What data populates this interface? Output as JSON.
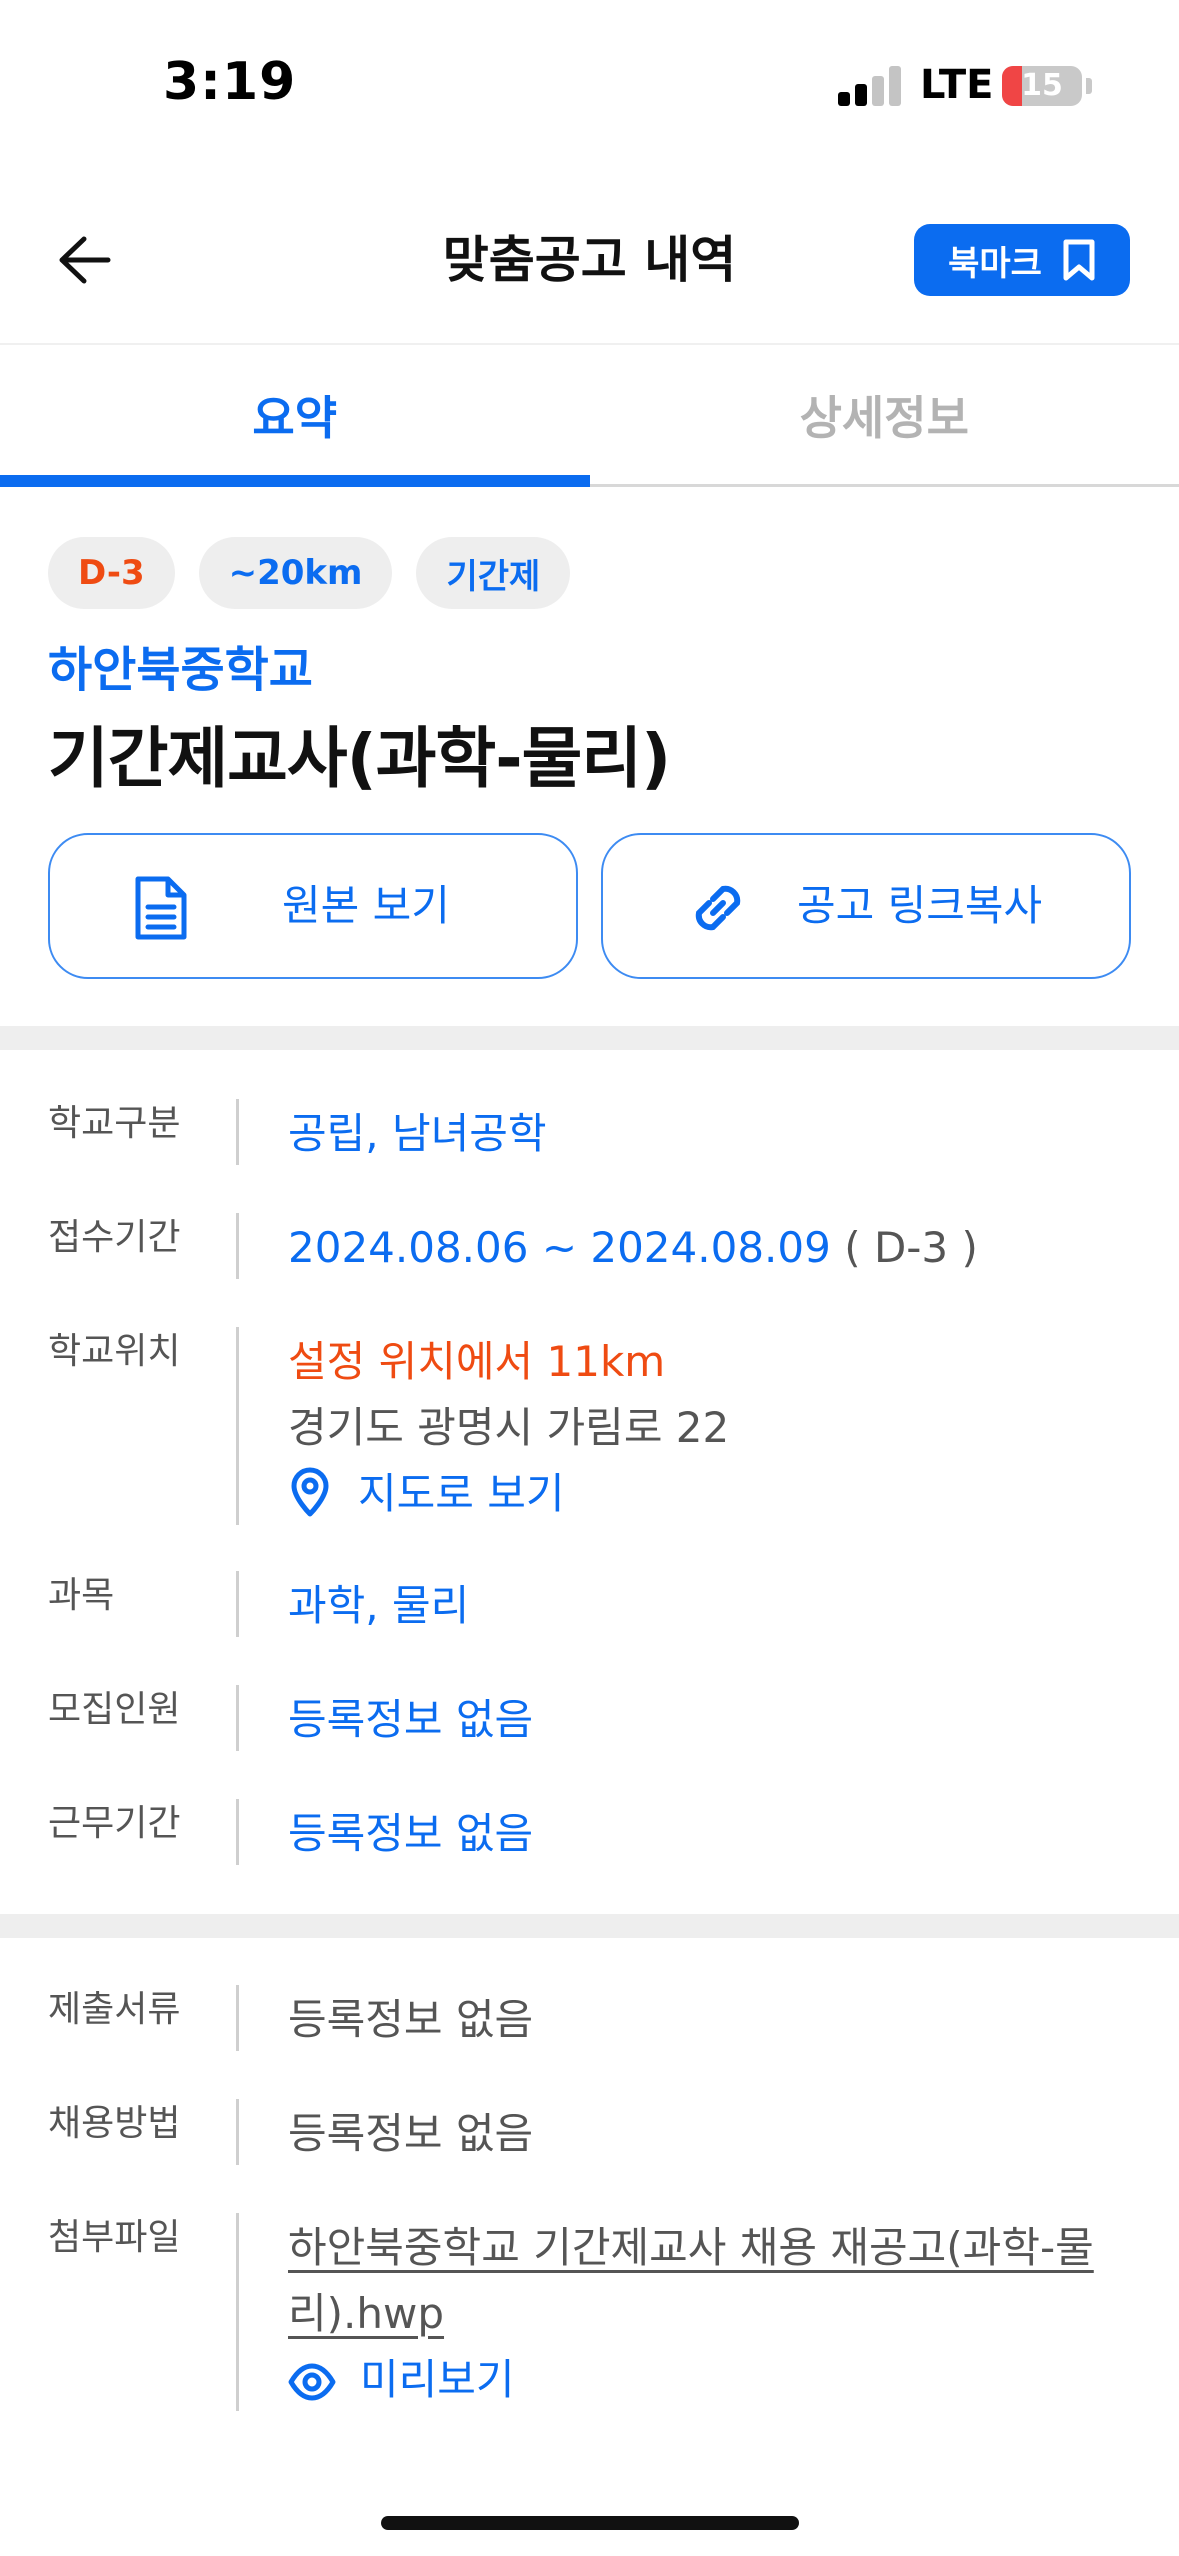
{
  "status_bar": {
    "time": "3:19",
    "network": "LTE",
    "battery": "15",
    "battery_level": 0.15
  },
  "header": {
    "title": "맞춤공고 내역",
    "bookmark_label": "북마크",
    "back_icon": "arrow-left-icon",
    "bookmark_icon": "bookmark-icon"
  },
  "tabs": [
    {
      "label": "요약",
      "active": true
    },
    {
      "label": "상세정보",
      "active": false
    }
  ],
  "summary": {
    "chips": [
      {
        "label": "D-3",
        "color": "#ef4b12"
      },
      {
        "label": "~20km",
        "color": "#0b6cf0"
      },
      {
        "label": "기간제",
        "color": "#0b6cf0"
      }
    ],
    "school_name": "하안북중학교",
    "job_title": "기간제교사(과학-물리)",
    "buttons": {
      "origin": "원본 보기",
      "copy_link": "공고 링크복사"
    }
  },
  "info": {
    "school_type": {
      "key": "학교구분",
      "value": "공립, 남녀공학"
    },
    "period": {
      "key": "접수기간",
      "value": "2024.08.06 ~ 2024.08.09",
      "dday": "( D-3 )"
    },
    "location": {
      "key": "학교위치",
      "distance": "설정 위치에서 11km",
      "address": "경기도 광명시 가림로 22",
      "map_link": "지도로 보기"
    },
    "subject": {
      "key": "과목",
      "value": "과학, 물리"
    },
    "recruit_count": {
      "key": "모집인원",
      "value": "등록정보 없음"
    },
    "work_period": {
      "key": "근무기간",
      "value": "등록정보 없음"
    }
  },
  "extra": {
    "documents": {
      "key": "제출서류",
      "value": "등록정보 없음"
    },
    "method": {
      "key": "채용방법",
      "value": "등록정보 없음"
    },
    "attachment": {
      "key": "첨부파일",
      "file_line1": "하안북중학교 기간제교사 채용 재공고(과학-물",
      "file_line2": "리).hwp",
      "preview": "미리보기"
    }
  },
  "colors": {
    "accent": "#0b6cf0",
    "warning": "#ef4b12",
    "muted": "#555555"
  }
}
